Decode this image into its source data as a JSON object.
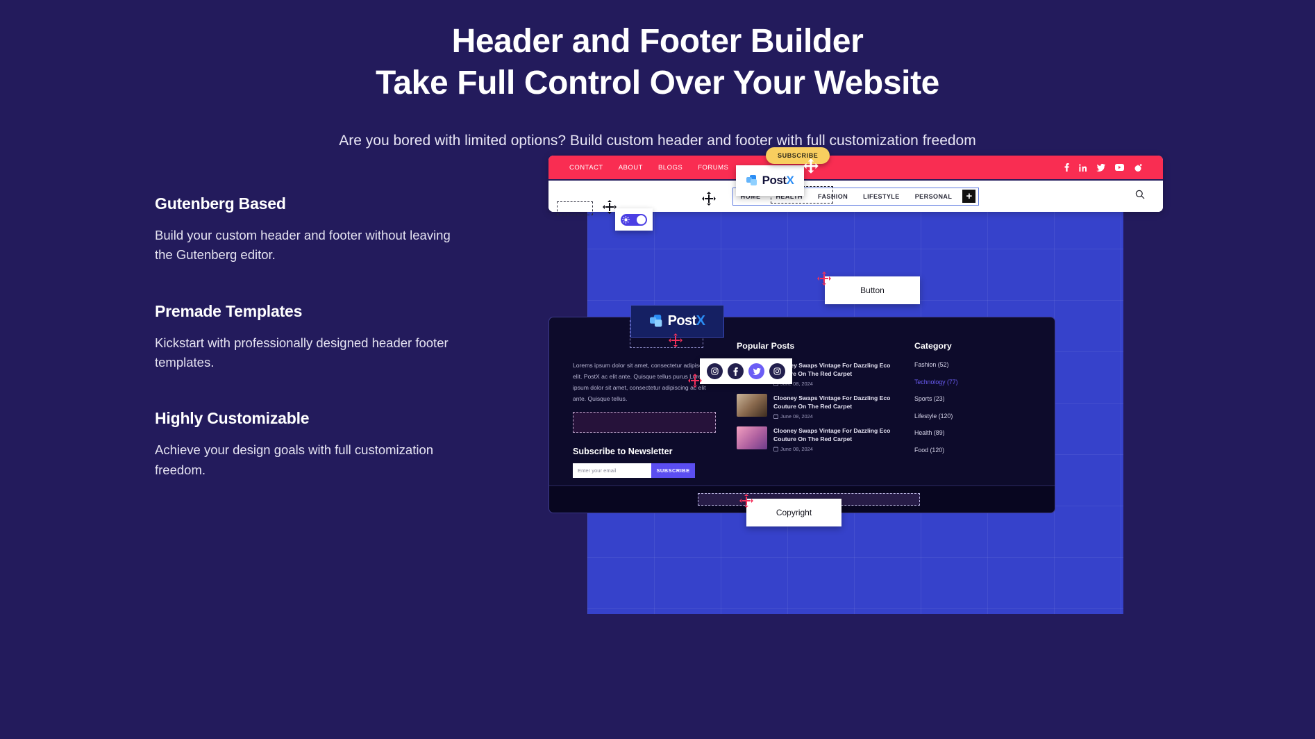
{
  "hero": {
    "title_line1": "Header and Footer Builder",
    "title_line2": "Take Full Control Over Your Website",
    "subtitle": "Are you bored with limited options? Build custom header and footer with full customization freedom"
  },
  "features": [
    {
      "heading": "Gutenberg Based",
      "body": "Build your custom header and footer without leaving the Gutenberg editor."
    },
    {
      "heading": "Premade Templates",
      "body": "Kickstart with professionally designed header footer templates."
    },
    {
      "heading": "Highly Customizable",
      "body": "Achieve your design goals with full customization freedom."
    }
  ],
  "mockup": {
    "header": {
      "nav_primary": [
        "CONTACT",
        "ABOUT",
        "BLOGS",
        "FORUMS"
      ],
      "social_icons": [
        "facebook-icon",
        "linkedin-icon",
        "twitter-icon",
        "youtube-icon",
        "reddit-icon"
      ],
      "nav_secondary": [
        "HOME",
        "HEALTH",
        "FASHION",
        "LIFESTYLE",
        "PERSONAL"
      ],
      "nav_secondary_add": "+",
      "search_icon": "search-icon",
      "logo_text_main": "Post",
      "logo_text_accent": "X",
      "subscribe_pill": "SUBSCRIBE",
      "toggle_icon": "sun-icon"
    },
    "footer": {
      "about_text": "Lorems ipsum dolor sit amet, consectetur adipiscing elit. PostX ac elit ante. Quisque tellus purus Lorems ipsum dolor sit amet, consectetur adipiscing ac elit ante. Quisque tellus.",
      "newsletter_heading": "Subscribe to Newsletter",
      "newsletter_placeholder": "Enter your email",
      "newsletter_button": "SUBSCRIBE",
      "logo_text_main": "Post",
      "logo_text_accent": "X",
      "social_icons": [
        "instagram-icon",
        "facebook-icon",
        "twitter-icon",
        "instagram-icon"
      ],
      "popular_heading": "Popular Posts",
      "posts": [
        {
          "title": "Clooney Swaps Vintage For Dazzling Eco Couture On The Red Carpet",
          "date": "June 08, 2024"
        },
        {
          "title": "Clooney Swaps Vintage For Dazzling Eco Couture On The Red Carpet",
          "date": "June 08, 2024"
        },
        {
          "title": "Clooney Swaps Vintage For Dazzling Eco Couture On The Red Carpet",
          "date": "June 08, 2024"
        }
      ],
      "category_heading": "Category",
      "categories": [
        {
          "label": "Fashion (52)",
          "active": false
        },
        {
          "label": "Technology (77)",
          "active": true
        },
        {
          "label": "Sports (23)",
          "active": false
        },
        {
          "label": "Lifestyle (120)",
          "active": false
        },
        {
          "label": "Health (89)",
          "active": false
        },
        {
          "label": "Food (120)",
          "active": false
        }
      ]
    },
    "overlays": {
      "button_card": "Button",
      "copyright_card": "Copyright"
    }
  },
  "colors": {
    "page_bg": "#231b5c",
    "grid_blue": "#3642cb",
    "header_red": "#f92d52",
    "accent_yellow": "#f8ce5f",
    "accent_purple": "#5b4ef0",
    "footer_dark": "#0d0b2b",
    "drag_handle": "#f4315c"
  }
}
